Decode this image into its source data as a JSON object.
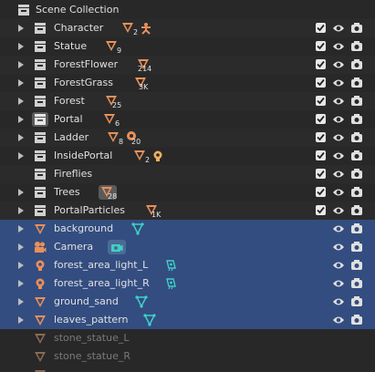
{
  "root": {
    "label": "Scene Collection"
  },
  "collections": [
    {
      "label": "Character",
      "count": "2",
      "extra": "armature"
    },
    {
      "label": "Statue",
      "count": "9"
    },
    {
      "label": "ForestFlower",
      "count": "214"
    },
    {
      "label": "ForestGrass",
      "count": "3K"
    },
    {
      "label": "Forest",
      "count": "25"
    },
    {
      "label": "Portal",
      "count": "6"
    },
    {
      "label": "Ladder",
      "count": "8",
      "extra2_count": "20"
    },
    {
      "label": "InsidePortal",
      "count": "2",
      "extra": "light"
    },
    {
      "label": "Fireflies"
    },
    {
      "label": "Trees",
      "count": "28"
    },
    {
      "label": "PortalParticles",
      "count": "1K"
    }
  ],
  "objects": [
    {
      "label": "background",
      "type": "mesh",
      "data_icon": "mesh-data-icon"
    },
    {
      "label": "Camera",
      "type": "camera",
      "data_icon": "camera-data-icon"
    },
    {
      "label": "forest_area_light_L",
      "type": "light",
      "data_icon": "light-data-icon"
    },
    {
      "label": "forest_area_light_R",
      "type": "light",
      "data_icon": "light-data-icon"
    },
    {
      "label": "ground_sand",
      "type": "mesh",
      "data_icon": "mesh-data-icon"
    },
    {
      "label": "leaves_pattern",
      "type": "mesh",
      "data_icon": "mesh-data-icon"
    }
  ],
  "hidden_objects": [
    {
      "label": "stone_statue_L"
    },
    {
      "label": "stone_statue_R"
    }
  ],
  "colors": {
    "selection": "#334d80",
    "object_orange": "#e8905a",
    "data_teal": "#3fd1c7",
    "light_yellow": "#f0b060"
  }
}
